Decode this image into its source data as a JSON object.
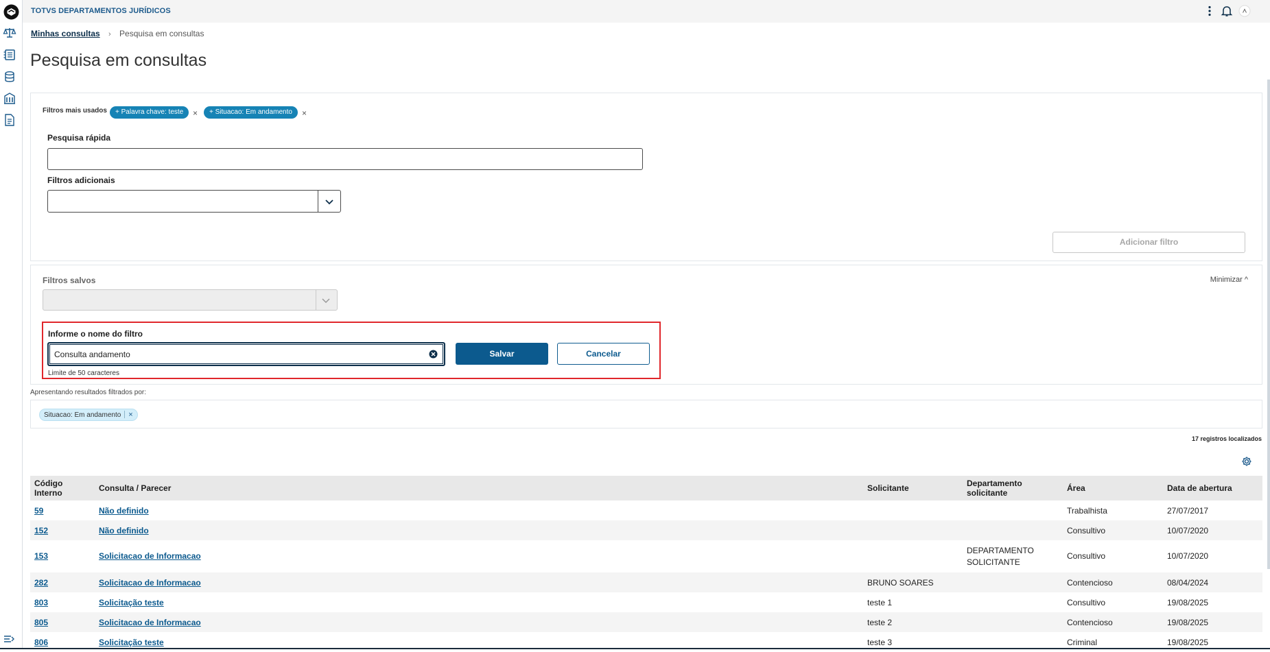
{
  "app": {
    "title": "TOTVS DEPARTAMENTOS JURÍDICOS"
  },
  "sidebar": {
    "icons": [
      "logo-icon",
      "scale-icon",
      "ledger-icon",
      "database-icon",
      "building-icon",
      "document-icon",
      "collapse-menu-icon"
    ]
  },
  "topbar": {
    "icons": [
      "more-vertical-icon",
      "bell-icon",
      "user-icon"
    ]
  },
  "breadcrumb": {
    "parent": "Minhas consultas",
    "separator": "›",
    "current": "Pesquisa em consultas"
  },
  "page": {
    "title": "Pesquisa em consultas"
  },
  "filters": {
    "fav_label": "Filtros mais usados",
    "fav_chips": [
      "+ Palavra chave: teste",
      "+ Situacao: Em andamento"
    ],
    "chip_close": "×",
    "quick_search_label": "Pesquisa rápida",
    "quick_search_value": "",
    "additional_label": "Filtros adicionais",
    "add_filter_button": "Adicionar filtro"
  },
  "saved_filters": {
    "label": "Filtros salvos",
    "minimize": "Minimizar ^",
    "name_label": "Informe o nome do filtro",
    "name_value": "Consulta andamento",
    "save_button": "Salvar",
    "cancel_button": "Cancelar",
    "helper": "Limite de 50 caracteres"
  },
  "results": {
    "label": "Apresentando resultados filtrados por:",
    "active_chip": "Situacao: Em andamento",
    "chip_close": "×",
    "count_text": "17 registros localizados"
  },
  "table": {
    "headers": [
      "Código Interno",
      "Consulta / Parecer",
      "Solicitante",
      "Departamento solicitante",
      "Área",
      "Data de abertura"
    ],
    "rows": [
      {
        "code": "59",
        "consulta": "Não definido",
        "solicitante": "",
        "departamento": "",
        "area": "Trabalhista",
        "data": "27/07/2017"
      },
      {
        "code": "152",
        "consulta": "Não definido",
        "solicitante": "",
        "departamento": "",
        "area": "Consultivo",
        "data": "10/07/2020"
      },
      {
        "code": "153",
        "consulta": "Solicitacao de Informacao",
        "solicitante": "",
        "departamento_line1": "DEPARTAMENTO",
        "departamento_line2": "SOLICITANTE",
        "area": "Consultivo",
        "data": "10/07/2020"
      },
      {
        "code": "282",
        "consulta": "Solicitacao de Informacao",
        "solicitante": "BRUNO SOARES",
        "departamento": "",
        "area": "Contencioso",
        "data": "08/04/2024"
      },
      {
        "code": "803",
        "consulta": "Solicitação teste",
        "solicitante": "teste 1",
        "departamento": "",
        "area": "Consultivo",
        "data": "19/08/2025"
      },
      {
        "code": "805",
        "consulta": "Solicitacao de Informacao",
        "solicitante": "teste 2",
        "departamento": "",
        "area": "Contencioso",
        "data": "19/08/2025"
      },
      {
        "code": "806",
        "consulta": "Solicitação teste",
        "solicitante": "teste 3",
        "departamento": "",
        "area": "Criminal",
        "data": "19/08/2025"
      }
    ]
  },
  "colors": {
    "brand": "#0c5a8e",
    "chip": "#1683b5",
    "highlight": "#e0262b",
    "header_bg": "#e8e8e8"
  }
}
